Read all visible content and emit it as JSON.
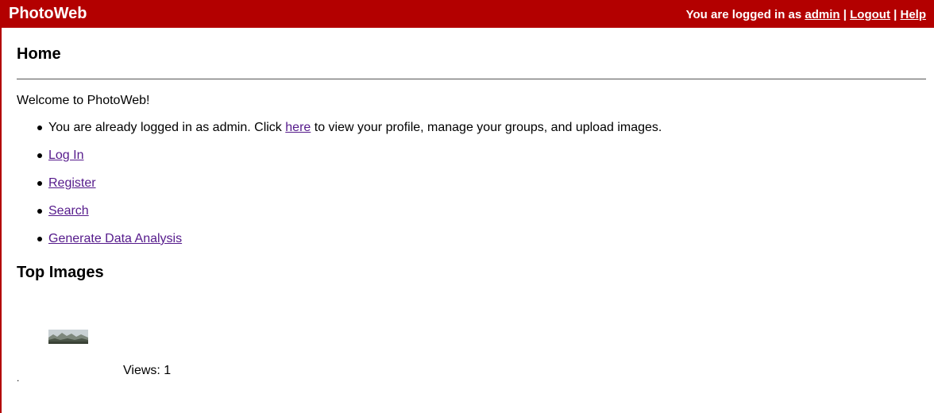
{
  "header": {
    "brand": "PhotoWeb",
    "logged_in_prefix": "You are logged in as",
    "username": "admin",
    "separator": "|",
    "logout_label": "Logout",
    "help_label": "Help"
  },
  "main": {
    "title": "Home",
    "welcome": "Welcome to PhotoWeb!",
    "items": [
      {
        "before": "You are already logged in as admin. Click",
        "link": "here",
        "after": "to view your profile, manage your groups, and upload images."
      },
      {
        "link": "Log In"
      },
      {
        "link": "Register"
      },
      {
        "link": "Search"
      },
      {
        "link": "Generate Data Analysis"
      }
    ]
  },
  "top_images": {
    "title": "Top Images",
    "images": [
      {
        "views_text": "Views: 1",
        "caption": "."
      }
    ]
  },
  "colors": {
    "header_bg": "#b30000",
    "link": "#551a8b"
  }
}
